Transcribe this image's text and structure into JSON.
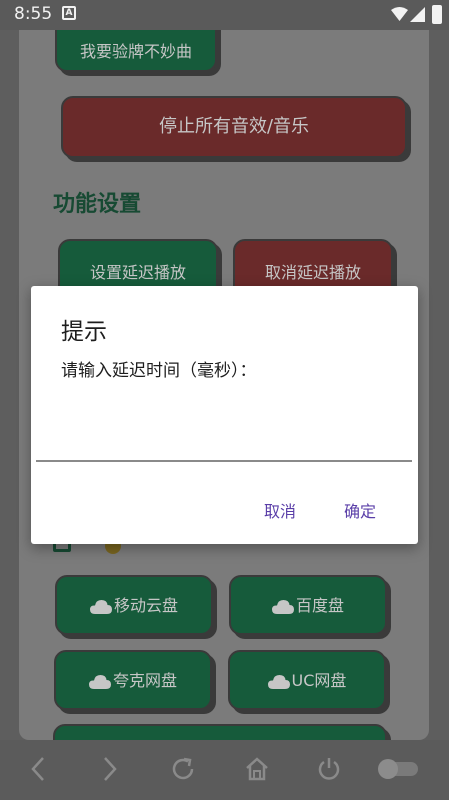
{
  "status_bar": {
    "time": "8:55",
    "notification_icon": "A"
  },
  "background": {
    "top_button": "我要验牌不妙曲",
    "stop_all_button": "停止所有音效/音乐",
    "section_title": "功能设置",
    "set_delay_button": "设置延迟播放",
    "cancel_delay_button": "取消延迟播放",
    "cloud_buttons": [
      "移动云盘",
      "百度盘",
      "夸克网盘",
      "UC网盘"
    ]
  },
  "dialog": {
    "title": "提示",
    "message": "请输入延迟时间（毫秒）：",
    "input_value": "",
    "cancel_label": "取消",
    "ok_label": "确定"
  },
  "colors": {
    "accent": "#5a3ea8",
    "green_button": "#165b3b",
    "red_button": "#6a2a2a"
  },
  "icons": [
    "wifi-icon",
    "signal-icon",
    "battery-icon",
    "cloud-icon",
    "back-icon",
    "forward-icon",
    "reload-icon",
    "home-icon",
    "power-icon",
    "toggle-icon"
  ]
}
